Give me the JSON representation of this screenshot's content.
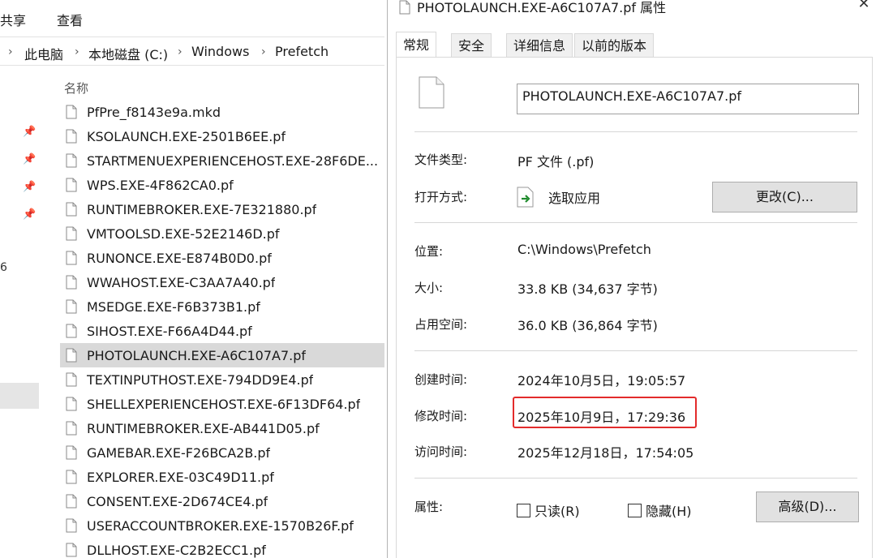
{
  "explorer": {
    "ribbon_tabs": [
      "共享",
      "查看"
    ],
    "breadcrumb": [
      "此电脑",
      "本地磁盘 (C:)",
      "Windows",
      "Prefetch"
    ],
    "nav_stray_text": "6",
    "column_header": "名称",
    "files": [
      "PfPre_f8143e9a.mkd",
      "KSOLAUNCH.EXE-2501B6EE.pf",
      "STARTMENUEXPERIENCEHOST.EXE-28F6DE...",
      "WPS.EXE-4F862CA0.pf",
      "RUNTIMEBROKER.EXE-7E321880.pf",
      "VMTOOLSD.EXE-52E2146D.pf",
      "RUNONCE.EXE-E874B0D0.pf",
      "WWAHOST.EXE-C3AA7A40.pf",
      "MSEDGE.EXE-F6B373B1.pf",
      "SIHOST.EXE-F66A4D44.pf",
      "PHOTOLAUNCH.EXE-A6C107A7.pf",
      "TEXTINPUTHOST.EXE-794DD9E4.pf",
      "SHELLEXPERIENCEHOST.EXE-6F13DF64.pf",
      "RUNTIMEBROKER.EXE-AB441D05.pf",
      "GAMEBAR.EXE-F26BCA2B.pf",
      "EXPLORER.EXE-03C49D11.pf",
      "CONSENT.EXE-2D674CE4.pf",
      "USERACCOUNTBROKER.EXE-1570B26F.pf",
      "DLLHOST.EXE-C2B2ECC1.pf"
    ],
    "selected_file": "PHOTOLAUNCH.EXE-A6C107A7.pf"
  },
  "dialog": {
    "title": "PHOTOLAUNCH.EXE-A6C107A7.pf 属性",
    "close_glyph": "✕",
    "tabs": [
      "常规",
      "安全",
      "详细信息",
      "以前的版本"
    ],
    "active_tab": "常规",
    "file_name": "PHOTOLAUNCH.EXE-A6C107A7.pf",
    "file_type_label": "文件类型:",
    "file_type_value": "PF 文件 (.pf)",
    "open_with_label": "打开方式:",
    "open_with_value": "选取应用",
    "change_button": "更改(C)...",
    "location_label": "位置:",
    "location_value": "C:\\Windows\\Prefetch",
    "size_label": "大小:",
    "size_value": "33.8 KB (34,637 字节)",
    "disk_size_label": "占用空间:",
    "disk_size_value": "36.0 KB (36,864 字节)",
    "created_label": "创建时间:",
    "created_value": "2024年10月5日，19:05:57",
    "modified_label": "修改时间:",
    "modified_value": "2025年10月9日，17:29:36",
    "accessed_label": "访问时间:",
    "accessed_value": "2025年12月18日，17:54:05",
    "attributes_label": "属性:",
    "readonly_label": "只读(R)",
    "hidden_label": "隐藏(H)",
    "advanced_button": "高级(D)...",
    "highlight_color": "#e32b2b"
  }
}
